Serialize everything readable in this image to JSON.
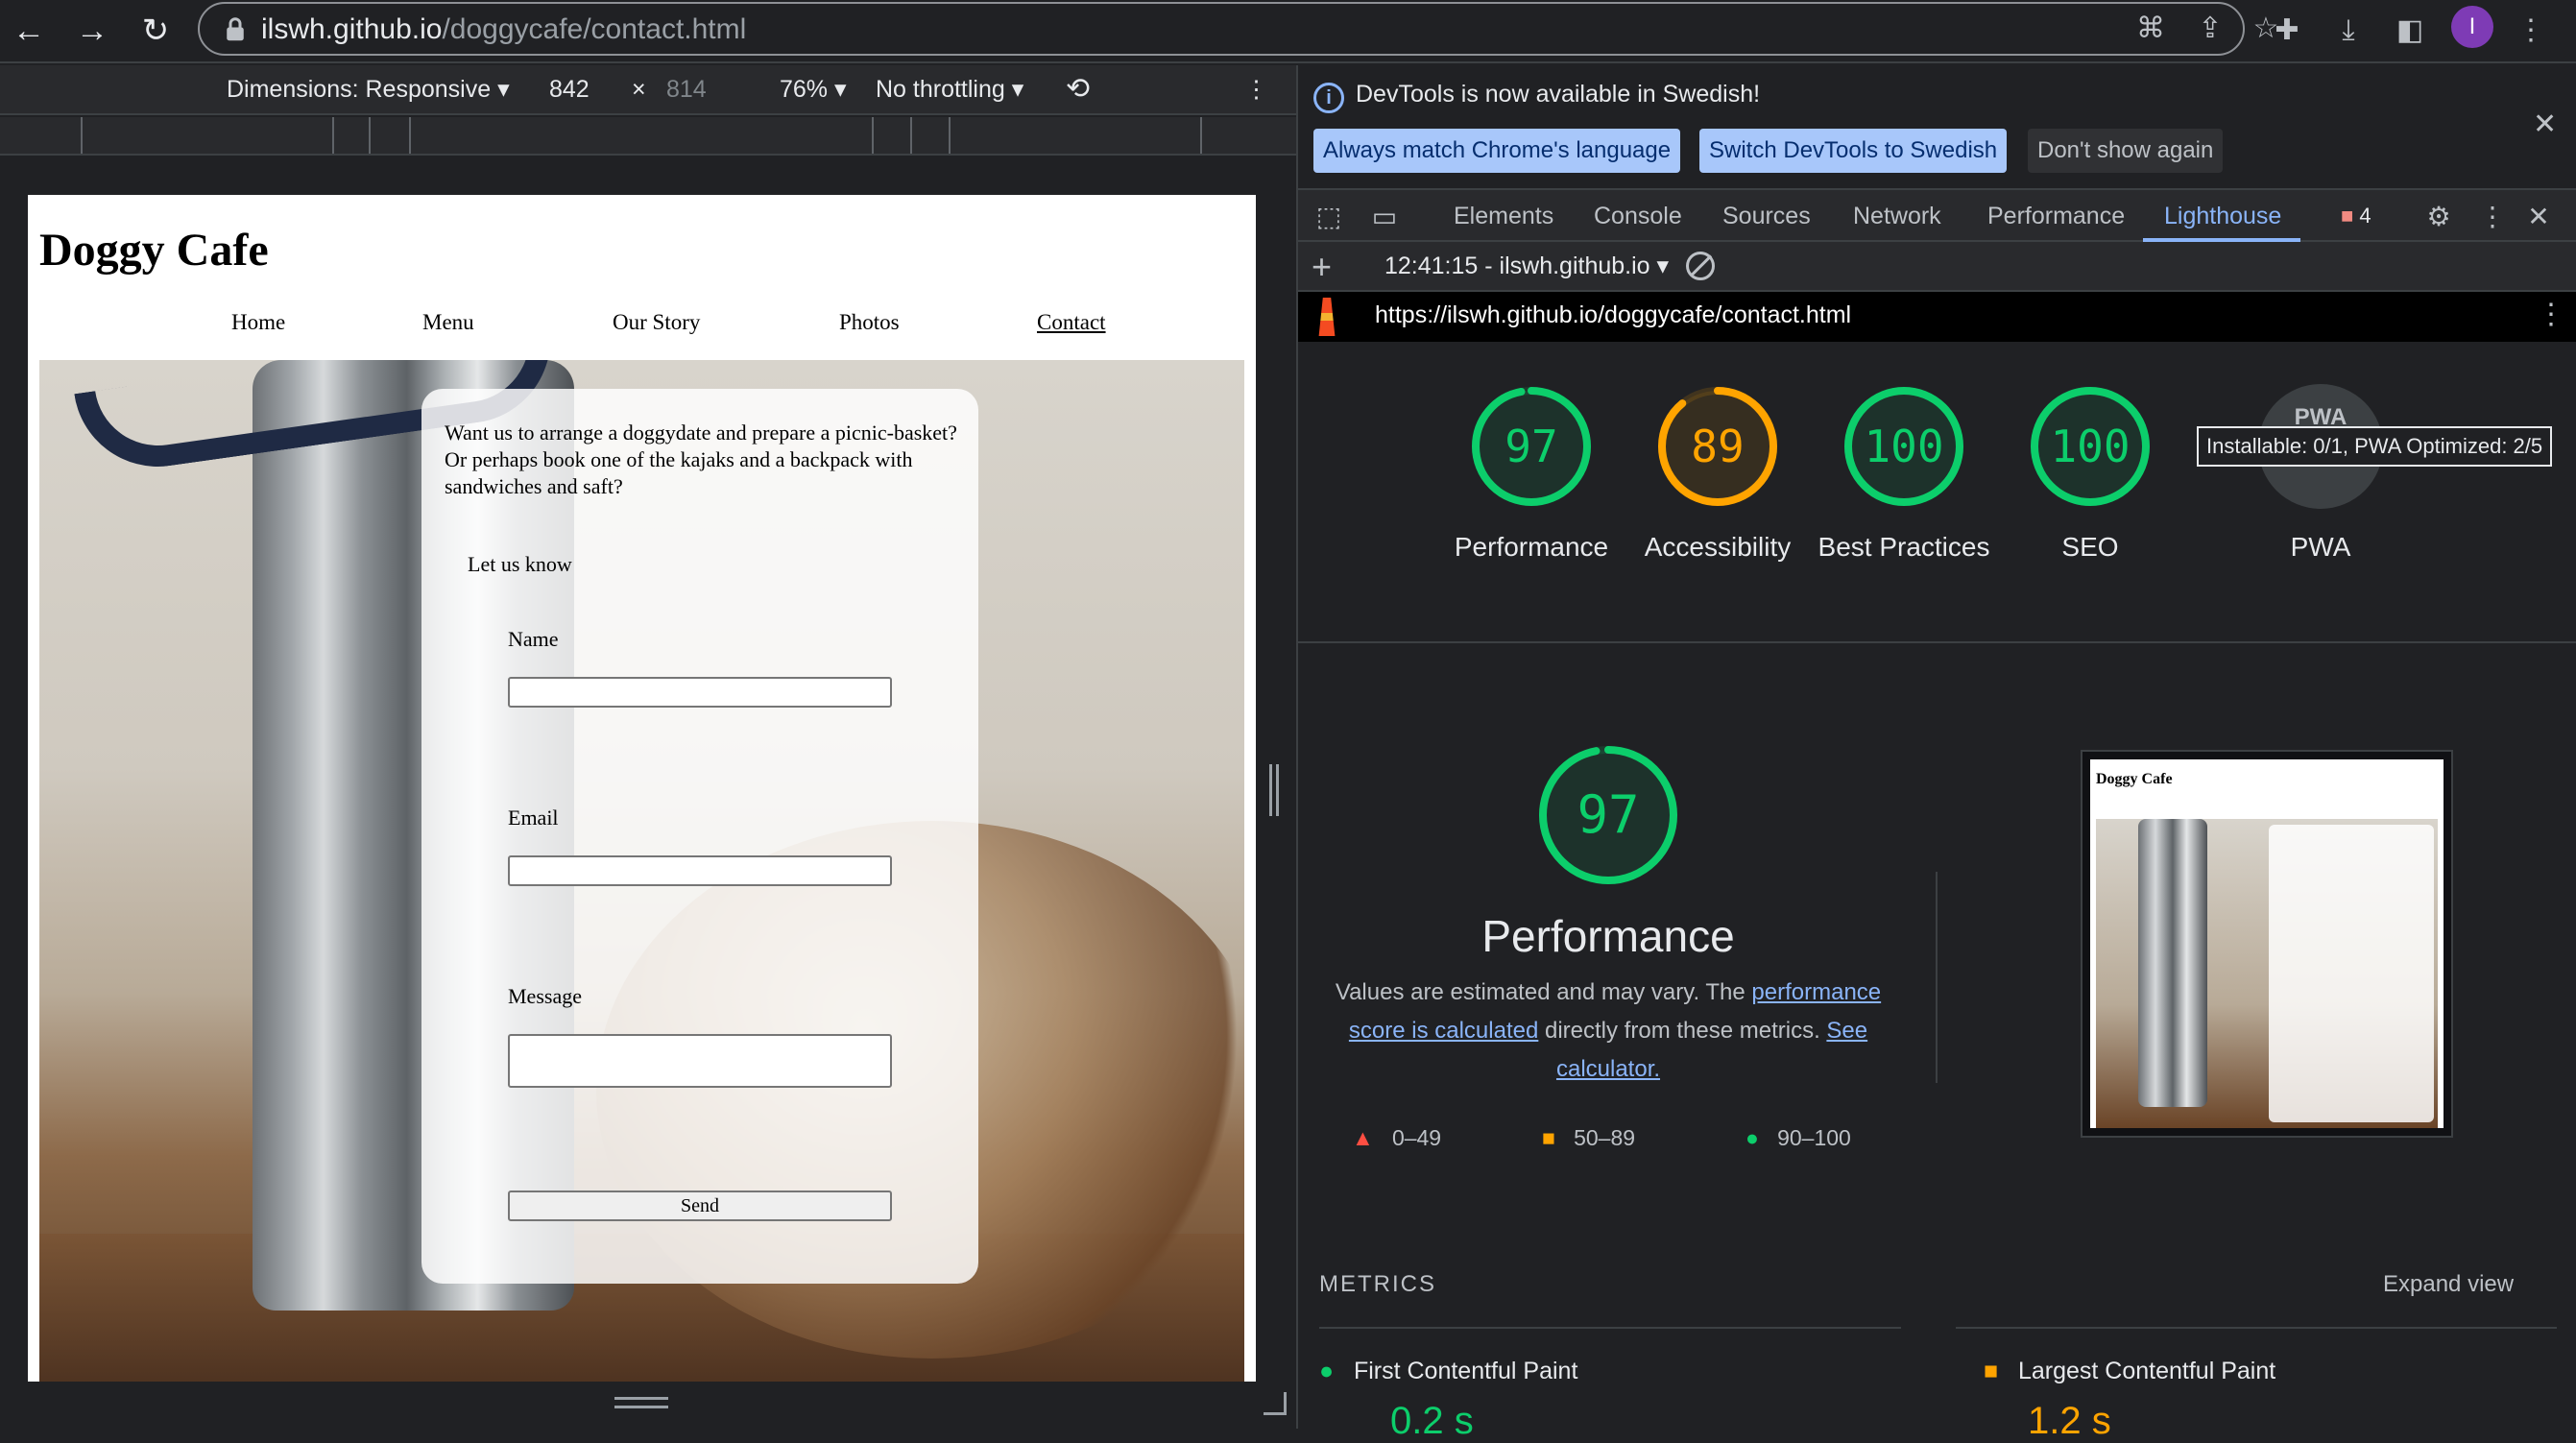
{
  "browser": {
    "url_domain": "ilswh.github.io",
    "url_path": "/doggycafe/contact.html",
    "profile_initial": "I"
  },
  "device_toolbar": {
    "dimensions_label": "Dimensions: Responsive",
    "width": "842",
    "times": "×",
    "height": "814",
    "zoom": "76%",
    "throttling": "No throttling"
  },
  "site": {
    "title": "Doggy Cafe",
    "nav": [
      "Home",
      "Menu",
      "Our Story",
      "Photos",
      "Contact"
    ],
    "active_nav": "Contact",
    "form": {
      "intro_line1": "Want us to arrange a doggydate and prepare a picnic-basket?",
      "intro_line2": "Or perhaps book one of the kajaks and a backpack with sandwiches and saft?",
      "let_us_know": "Let us know",
      "name_label": "Name",
      "email_label": "Email",
      "message_label": "Message",
      "send_label": "Send"
    }
  },
  "devtools": {
    "info_text": "DevTools is now available in Swedish!",
    "btn_match": "Always match Chrome's language",
    "btn_switch": "Switch DevTools to Swedish",
    "btn_dismiss": "Don't show again",
    "tabs": [
      "Elements",
      "Console",
      "Sources",
      "Network",
      "Performance",
      "Lighthouse"
    ],
    "active_tab": "Lighthouse",
    "error_count": "4",
    "report_label": "12:41:15 - ilswh.github.io",
    "report_url": "https://ilswh.github.io/doggycafe/contact.html"
  },
  "lighthouse": {
    "scores": [
      {
        "label": "Performance",
        "value": 97,
        "color": "#0cce6b"
      },
      {
        "label": "Accessibility",
        "value": 89,
        "color": "#ffa400"
      },
      {
        "label": "Best Practices",
        "value": 100,
        "color": "#0cce6b"
      },
      {
        "label": "SEO",
        "value": 100,
        "color": "#0cce6b"
      }
    ],
    "pwa_label": "PWA",
    "pwa_badge": "PWA",
    "pwa_tooltip": "Installable: 0/1, PWA Optimized: 2/5",
    "detail_title": "Performance",
    "detail_score": 97,
    "desc_prefix": "Values are estimated and may vary. The ",
    "desc_link1": "performance score is calculated",
    "desc_mid": " directly from these metrics. ",
    "desc_link2": "See calculator.",
    "legend": [
      "0–49",
      "50–89",
      "90–100"
    ],
    "thumb_title": "Doggy Cafe",
    "metrics_label": "METRICS",
    "expand_view": "Expand view",
    "metric_1": "First Contentful Paint",
    "metric_2": "Largest Contentful Paint",
    "metric_1_value": "0.2 s",
    "metric_2_value": "1.2 s",
    "colors": {
      "pass": "#0cce6b",
      "average": "#ffa400",
      "fail": "#ff4e42"
    }
  }
}
